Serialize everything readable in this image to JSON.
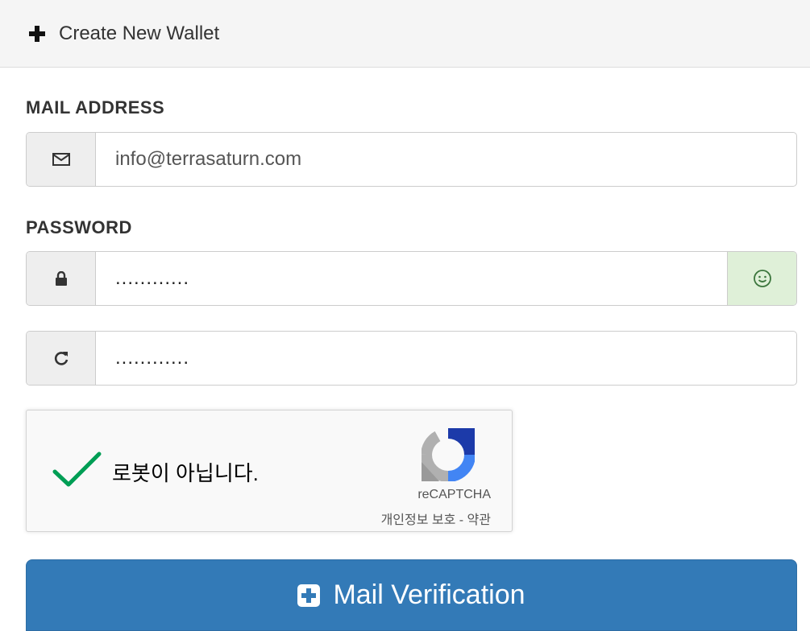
{
  "header": {
    "title": "Create New Wallet",
    "icon": "plus-icon"
  },
  "email": {
    "label": "MAIL ADDRESS",
    "value": "info@terrasaturn.com",
    "icon": "envelope-icon"
  },
  "password": {
    "label": "PASSWORD",
    "value": "............",
    "icon": "lock-icon",
    "status_icon": "smile-icon",
    "status_color": "#dff0d8"
  },
  "password_confirm": {
    "value": "............",
    "icon": "refresh-icon"
  },
  "recaptcha": {
    "label": "로봇이 아닙니다.",
    "brand": "reCAPTCHA",
    "links": "개인정보 보호 - 약관",
    "checked": true,
    "check_color": "#009e55"
  },
  "submit": {
    "label": "Mail Verification",
    "icon": "plus-square-icon",
    "color": "#337ab7"
  }
}
